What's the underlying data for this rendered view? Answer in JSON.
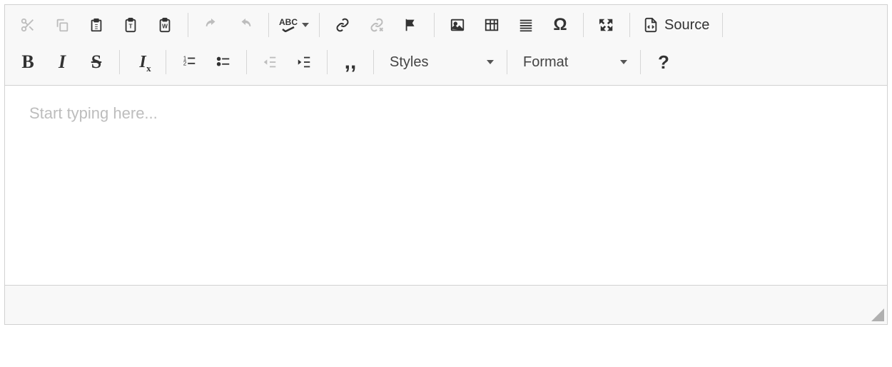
{
  "toolbar": {
    "source_label": "Source",
    "spell_label": "ABC"
  },
  "combos": {
    "styles": "Styles",
    "format": "Format"
  },
  "editor": {
    "placeholder": "Start typing here..."
  }
}
